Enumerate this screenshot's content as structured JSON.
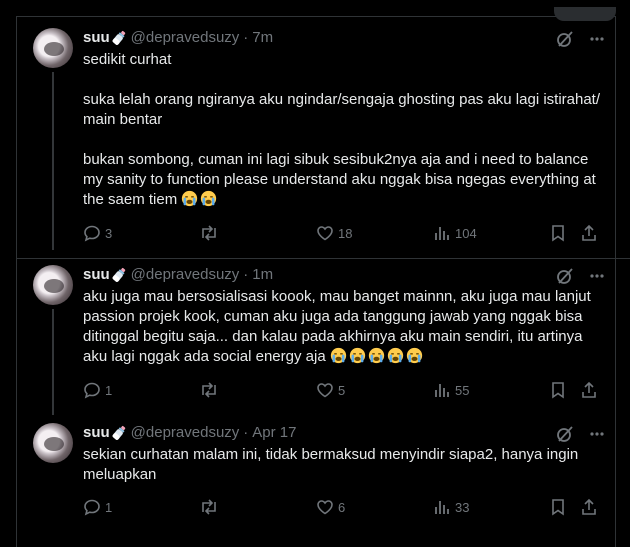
{
  "tweets": [
    {
      "name": "suu",
      "handle": "@depravedsuzy",
      "separator": "·",
      "time": "7m",
      "text": "sedikit curhat\n\nsuka lelah orang ngiranya aku ngindar/sengaja ghosting pas aku lagi istirahat/\nmain bentar\n\nbukan sombong, cuman ini lagi sibuk sesibuk2nya aja and i need to balance\nmy sanity to function please understand aku nggak bisa ngegas everything at\nthe saem tiem ",
      "emoji_count": 2,
      "replies": "3",
      "reposts": "",
      "likes": "18",
      "views": "104"
    },
    {
      "name": "suu",
      "handle": "@depravedsuzy",
      "separator": "·",
      "time": "1m",
      "text": "aku juga mau bersosialisasi koook, mau banget mainnn, aku juga mau lanjut\npassion projek kook, cuman aku juga ada tanggung jawab yang nggak bisa\nditinggal begitu saja... dan kalau pada akhirnya aku main sendiri, itu artinya\naku lagi nggak ada social energy aja ",
      "emoji_count": 5,
      "replies": "1",
      "reposts": "",
      "likes": "5",
      "views": "55"
    },
    {
      "name": "suu",
      "handle": "@depravedsuzy",
      "separator": "·",
      "time": "Apr 17",
      "text": "sekian curhatan malam ini, tidak bermaksud menyindir siapa2, hanya ingin\nmeluapkan",
      "emoji_count": 0,
      "replies": "1",
      "reposts": "",
      "likes": "6",
      "views": "33"
    }
  ],
  "icons": {
    "verified_bottle": "baby-bottle-icon",
    "grok": "grok-icon",
    "more": "more-icon",
    "reply": "reply-icon",
    "repost": "repost-icon",
    "like": "like-icon",
    "views": "views-icon",
    "bookmark": "bookmark-icon",
    "share": "share-icon",
    "crying": "loudly-crying-face-emoji"
  },
  "colors": {
    "background": "#000000",
    "text": "#e7e9ea",
    "muted": "#71767b",
    "border": "#2f3336"
  }
}
